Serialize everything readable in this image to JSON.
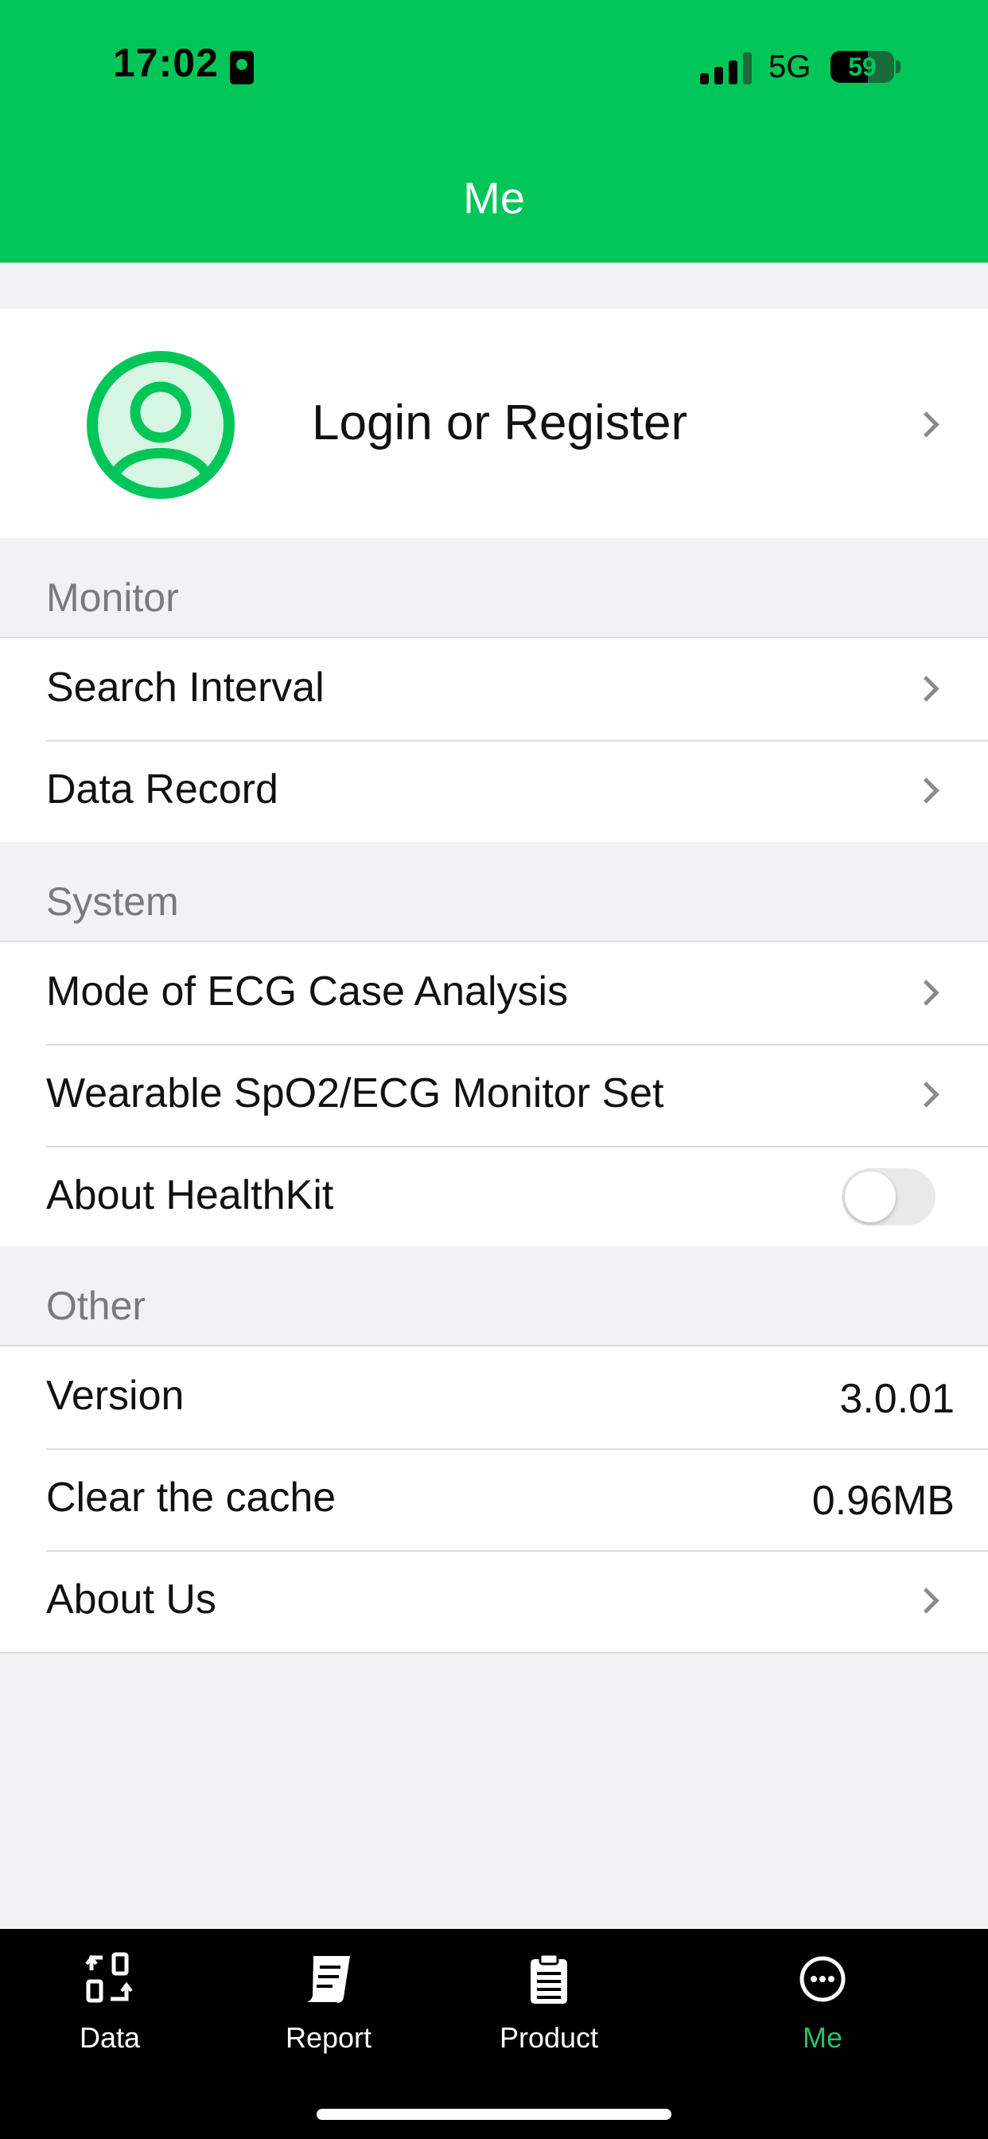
{
  "status_bar": {
    "time": "17:02",
    "network": "5G",
    "battery": "59",
    "battery_level": 0.59
  },
  "header": {
    "title": "Me"
  },
  "profile": {
    "label": "Login or Register"
  },
  "sections": {
    "monitor": {
      "title": "Monitor",
      "items": [
        {
          "label": "Search Interval"
        },
        {
          "label": "Data Record"
        }
      ]
    },
    "system": {
      "title": "System",
      "items": [
        {
          "label": "Mode of ECG Case Analysis"
        },
        {
          "label": "Wearable SpO2/ECG Monitor Set"
        },
        {
          "label": "About HealthKit",
          "toggle_on": false
        }
      ]
    },
    "other": {
      "title": "Other",
      "items": [
        {
          "label": "Version",
          "value": "3.0.01"
        },
        {
          "label": "Clear the cache",
          "value": "0.96MB"
        },
        {
          "label": "About Us"
        }
      ]
    }
  },
  "tabbar": {
    "tabs": [
      {
        "label": "Data",
        "icon": "data-icon"
      },
      {
        "label": "Report",
        "icon": "report-icon"
      },
      {
        "label": "Product",
        "icon": "product-icon"
      },
      {
        "label": "Me",
        "icon": "me-icon",
        "active": true
      }
    ]
  },
  "colors": {
    "accent": "#00c65a",
    "tab_active": "#22c55e"
  }
}
